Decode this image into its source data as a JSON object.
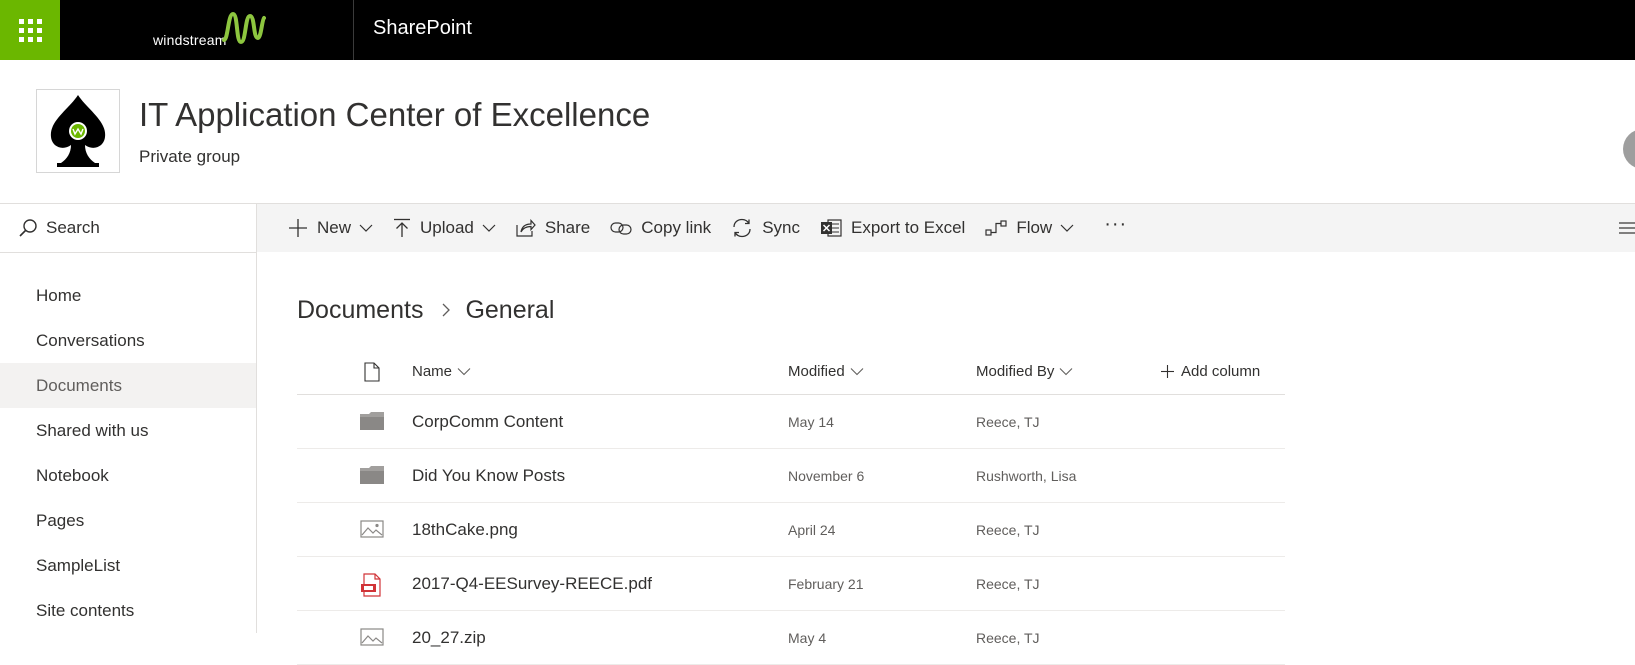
{
  "suitebar": {
    "brand": "windstream",
    "app_name": "SharePoint"
  },
  "site": {
    "title": "IT Application Center of Excellence",
    "subtitle": "Private group"
  },
  "leftnav": {
    "search_label": "Search",
    "items": [
      {
        "label": "Home"
      },
      {
        "label": "Conversations"
      },
      {
        "label": "Documents"
      },
      {
        "label": "Shared with us"
      },
      {
        "label": "Notebook"
      },
      {
        "label": "Pages"
      },
      {
        "label": "SampleList"
      },
      {
        "label": "Site contents"
      }
    ]
  },
  "commandbar": {
    "new": "New",
    "upload": "Upload",
    "share": "Share",
    "copy_link": "Copy link",
    "sync": "Sync",
    "export": "Export to Excel",
    "flow": "Flow",
    "more": "···"
  },
  "breadcrumb": {
    "items": [
      "Documents",
      "General"
    ]
  },
  "list": {
    "columns": {
      "name": "Name",
      "modified": "Modified",
      "modified_by": "Modified By",
      "add_column": "Add column"
    },
    "rows": [
      {
        "name": "CorpComm Content",
        "modified": "May 14",
        "modified_by": "Reece, TJ",
        "type": "folder-icon"
      },
      {
        "name": "Did You Know Posts",
        "modified": "November 6",
        "modified_by": "Rushworth, Lisa",
        "type": "folder-icon"
      },
      {
        "name": "18thCake.png",
        "modified": "April 24",
        "modified_by": "Reece, TJ",
        "type": "image-file-icon"
      },
      {
        "name": "2017-Q4-EESurvey-REECE.pdf",
        "modified": "February 21",
        "modified_by": "Reece, TJ",
        "type": "pdf-file-icon"
      },
      {
        "name": "20_27.zip",
        "modified": "May 4",
        "modified_by": "Reece, TJ",
        "type": "image-file-icon"
      }
    ]
  },
  "colors": {
    "suitebar_bg": "#000000",
    "waffle_bg": "#6bb700",
    "brand_wave": "#8dc63f",
    "nav_active_bg": "#f3f2f1",
    "pdf_red": "#d13438"
  }
}
